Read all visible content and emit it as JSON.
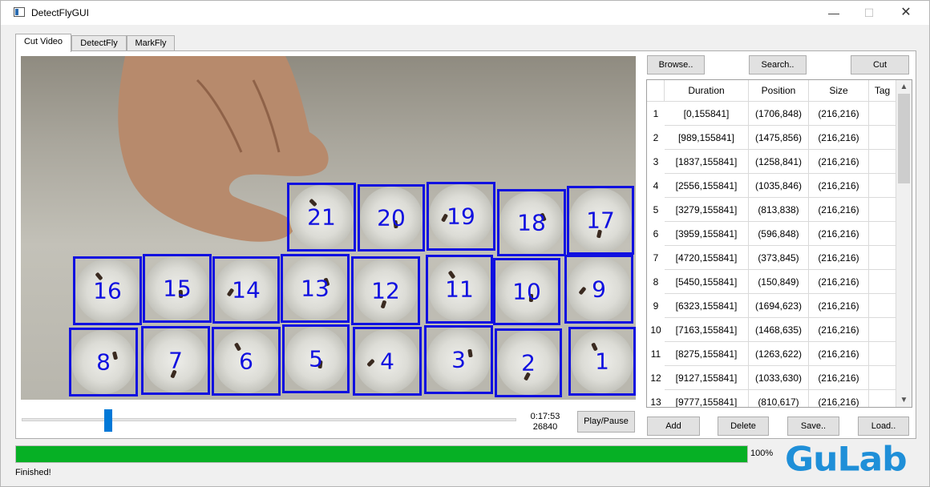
{
  "window": {
    "title": "DetectFlyGUI",
    "minimize": "—",
    "maximize": "☐",
    "close": "✕"
  },
  "tabs": [
    {
      "label": "Cut Video",
      "active": true
    },
    {
      "label": "DetectFly",
      "active": false
    },
    {
      "label": "MarkFly",
      "active": false
    }
  ],
  "video": {
    "regions": [
      "21",
      "20",
      "19",
      "18",
      "17",
      "16",
      "15",
      "14",
      "13",
      "12",
      "11",
      "10",
      "9",
      "8",
      "7",
      "6",
      "5",
      "4",
      "3",
      "2",
      "1"
    ],
    "box_color": "#1010e0"
  },
  "playback": {
    "time": "0:17:53",
    "frame": "26840",
    "play_pause": "Play/Pause",
    "slider_position_fraction": 0.173
  },
  "toolbar": {
    "browse": "Browse..",
    "search": "Search..",
    "cut": "Cut"
  },
  "table": {
    "headers": [
      "Duration",
      "Position",
      "Size",
      "Tag"
    ],
    "rows": [
      {
        "num": "1",
        "duration": "[0,155841]",
        "position": "(1706,848)",
        "size": "(216,216)",
        "tag": ""
      },
      {
        "num": "2",
        "duration": "[989,155841]",
        "position": "(1475,856)",
        "size": "(216,216)",
        "tag": ""
      },
      {
        "num": "3",
        "duration": "[1837,155841]",
        "position": "(1258,841)",
        "size": "(216,216)",
        "tag": ""
      },
      {
        "num": "4",
        "duration": "[2556,155841]",
        "position": "(1035,846)",
        "size": "(216,216)",
        "tag": ""
      },
      {
        "num": "5",
        "duration": "[3279,155841]",
        "position": "(813,838)",
        "size": "(216,216)",
        "tag": ""
      },
      {
        "num": "6",
        "duration": "[3959,155841]",
        "position": "(596,848)",
        "size": "(216,216)",
        "tag": ""
      },
      {
        "num": "7",
        "duration": "[4720,155841]",
        "position": "(373,845)",
        "size": "(216,216)",
        "tag": ""
      },
      {
        "num": "8",
        "duration": "[5450,155841]",
        "position": "(150,849)",
        "size": "(216,216)",
        "tag": ""
      },
      {
        "num": "9",
        "duration": "[6323,155841]",
        "position": "(1694,623)",
        "size": "(216,216)",
        "tag": ""
      },
      {
        "num": "10",
        "duration": "[7163,155841]",
        "position": "(1468,635)",
        "size": "(216,216)",
        "tag": ""
      },
      {
        "num": "11",
        "duration": "[8275,155841]",
        "position": "(1263,622)",
        "size": "(216,216)",
        "tag": ""
      },
      {
        "num": "12",
        "duration": "[9127,155841]",
        "position": "(1033,630)",
        "size": "(216,216)",
        "tag": ""
      },
      {
        "num": "13",
        "duration": "[9777,155841]",
        "position": "(810,617)",
        "size": "(216,216)",
        "tag": ""
      }
    ]
  },
  "actions": {
    "add": "Add",
    "delete": "Delete",
    "save": "Save..",
    "load": "Load.."
  },
  "progress": {
    "value_fraction": 1.0,
    "text": "100%",
    "color": "#06b025"
  },
  "status": "Finished!",
  "logo": {
    "text": "GuLab",
    "color": "#1f8fd8"
  }
}
